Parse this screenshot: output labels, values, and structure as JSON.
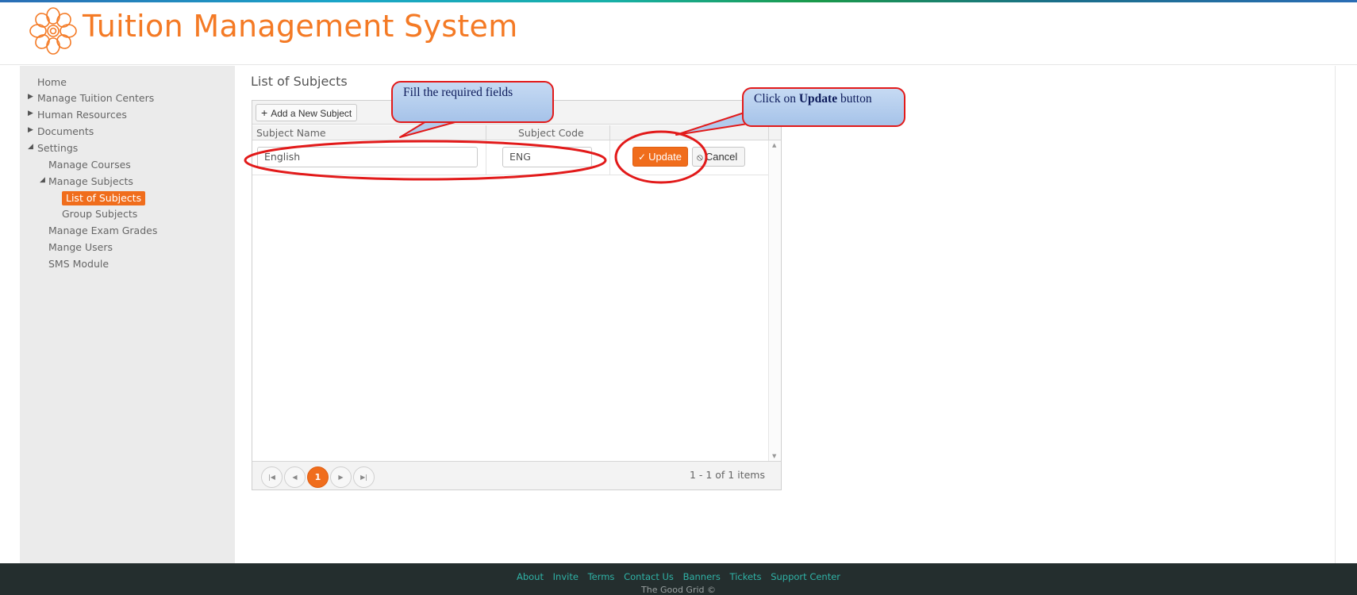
{
  "app": {
    "title": "Tuition Management System",
    "brand_color": "#f47a25"
  },
  "sidebar": {
    "items": [
      {
        "label": "Home",
        "arrow": ""
      },
      {
        "label": "Manage Tuition Centers",
        "arrow": "▶"
      },
      {
        "label": "Human Resources",
        "arrow": "▶"
      },
      {
        "label": "Documents",
        "arrow": "▶"
      },
      {
        "label": "Settings",
        "arrow": "◢"
      },
      {
        "label": "Manage Courses",
        "arrow": ""
      },
      {
        "label": "Manage Subjects",
        "arrow": "◢"
      },
      {
        "label": "List of Subjects",
        "arrow": "",
        "active": true
      },
      {
        "label": "Group Subjects",
        "arrow": ""
      },
      {
        "label": "Manage Exam Grades",
        "arrow": ""
      },
      {
        "label": "Mange Users",
        "arrow": ""
      },
      {
        "label": "SMS Module",
        "arrow": ""
      }
    ]
  },
  "main": {
    "title": "List of Subjects",
    "toolbar": {
      "add_icon": "plus-icon",
      "add_label": "Add a New Subject"
    },
    "columns": [
      "Subject Name",
      "Subject Code"
    ],
    "edit_row": {
      "subject_name": "English",
      "subject_code": "ENG",
      "update_label": "Update",
      "update_icon": "check-icon",
      "cancel_label": "Cancel",
      "cancel_icon": "cancel-icon"
    },
    "pager": {
      "current_page": "1",
      "info": "1 - 1 of 1 items"
    }
  },
  "callouts": {
    "fields_text": "Fill the required fields",
    "update_prefix": "Click on ",
    "update_bold": "Update",
    "update_suffix": " button"
  },
  "footer": {
    "links": [
      "About",
      "Invite",
      "Terms",
      "Contact Us",
      "Banners",
      "Tickets",
      "Support Center"
    ],
    "copyright": "The Good Grid ©"
  },
  "colors": {
    "accent": "#f06d1c",
    "annotation_red": "#e21a1a",
    "callout_fill": "#b6cfee",
    "footer_bg": "#242e2e",
    "footer_link": "#2fb2a6"
  }
}
